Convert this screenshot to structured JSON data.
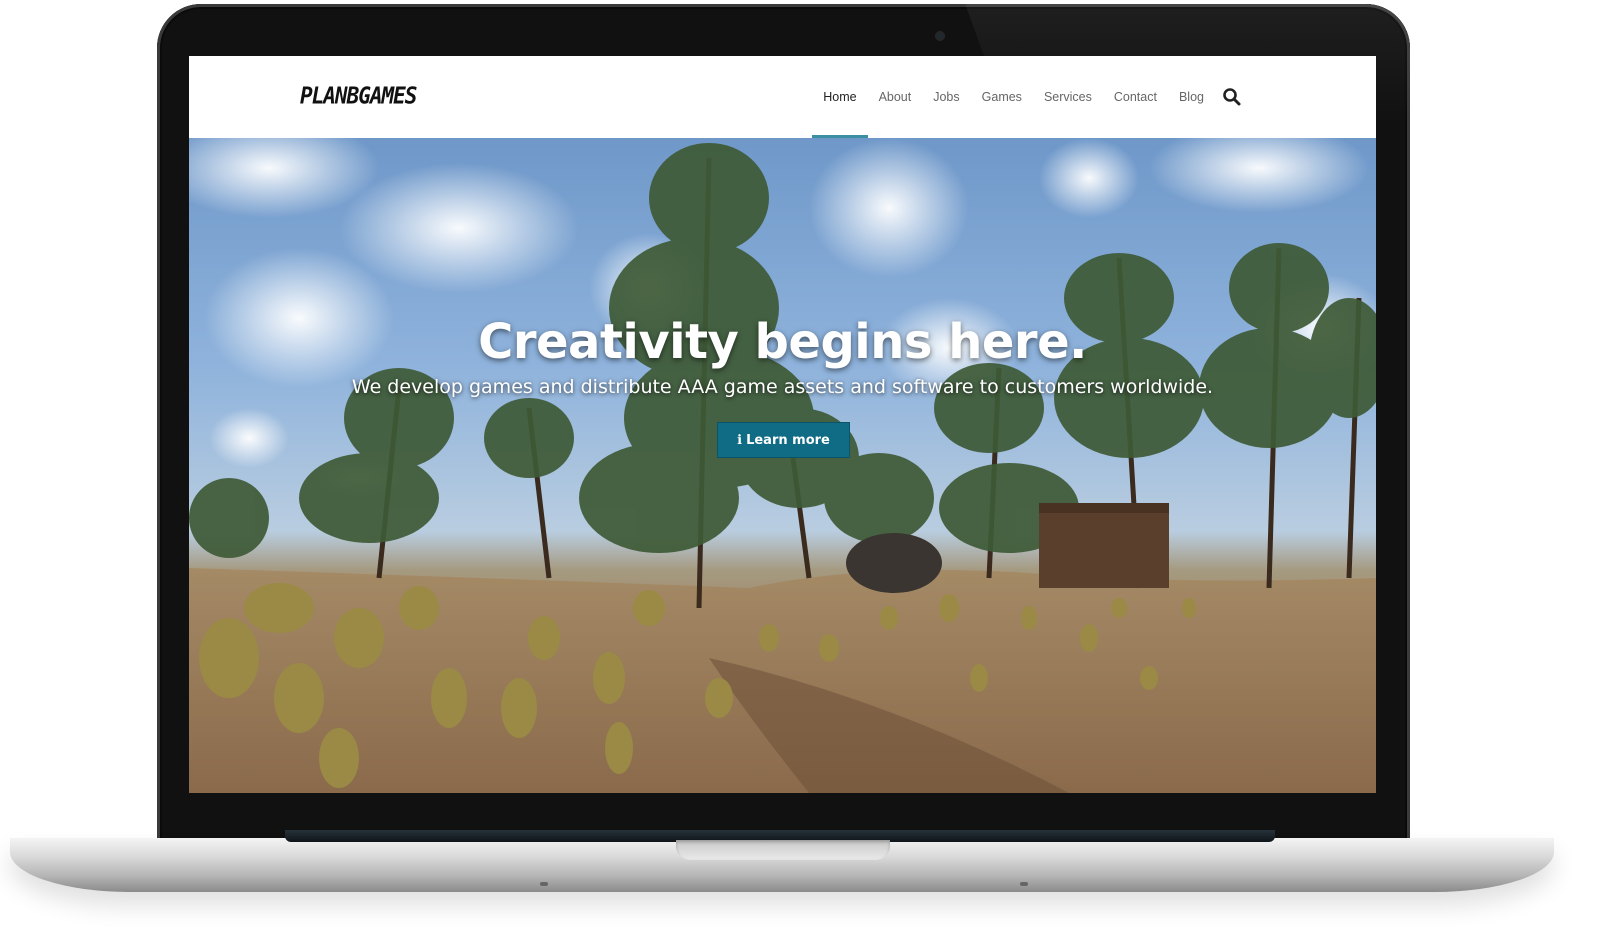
{
  "site": {
    "logo_text": "PLANBGAMES"
  },
  "nav": {
    "items": [
      {
        "label": "Home",
        "active": true
      },
      {
        "label": "About",
        "active": false
      },
      {
        "label": "Jobs",
        "active": false
      },
      {
        "label": "Games",
        "active": false
      },
      {
        "label": "Services",
        "active": false
      },
      {
        "label": "Contact",
        "active": false
      },
      {
        "label": "Blog",
        "active": false
      }
    ],
    "search_icon": "search-icon",
    "active_color": "#3a8fa0"
  },
  "hero": {
    "title": "Creativity begins here.",
    "subtitle": "We develop games and distribute AAA game assets and software to customers worldwide.",
    "button": {
      "icon": "info-icon",
      "icon_glyph": "ℹ",
      "label": "Learn more",
      "color": "#106b85"
    }
  }
}
